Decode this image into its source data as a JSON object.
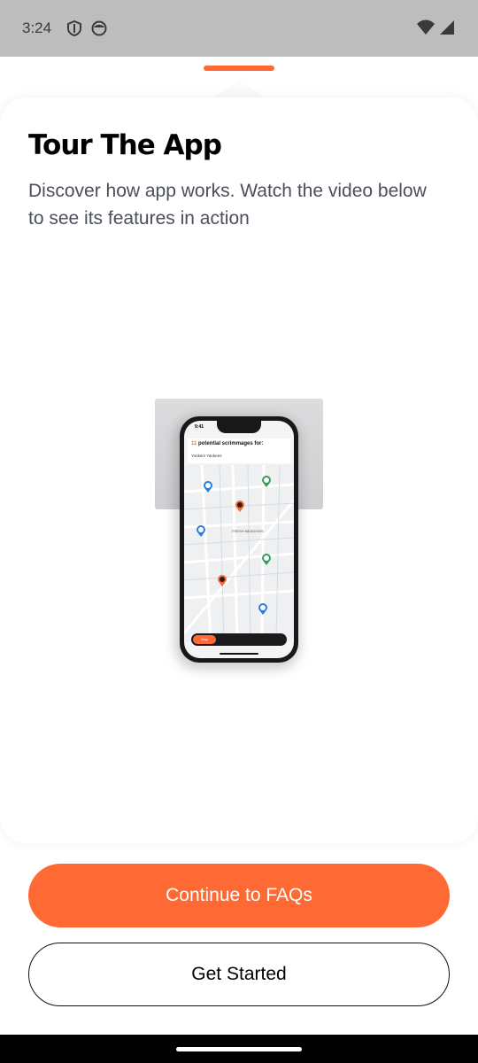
{
  "status_bar": {
    "time": "3:24",
    "left_icons": [
      "shield-icon",
      "face-icon"
    ],
    "right_icons": [
      "wifi-icon",
      "cellular-signal-icon"
    ]
  },
  "sheet": {
    "title": "Tour The App",
    "subtitle": "Discover how app works. Watch the video below to see its features in action"
  },
  "video_preview": {
    "phone_time": "9:41",
    "count": "11",
    "heading": "potential scrimmages for:",
    "team": "Yonkers Yankees",
    "map_area_label": "FRESH MEADOWS",
    "nav_map_label": "Map"
  },
  "buttons": {
    "primary_label": "Continue to FAQs",
    "secondary_label": "Get Started"
  },
  "colors": {
    "accent": "#ff6a34",
    "status_bar_bg": "#bdbdbd",
    "nav_bar_bg": "#000000"
  }
}
